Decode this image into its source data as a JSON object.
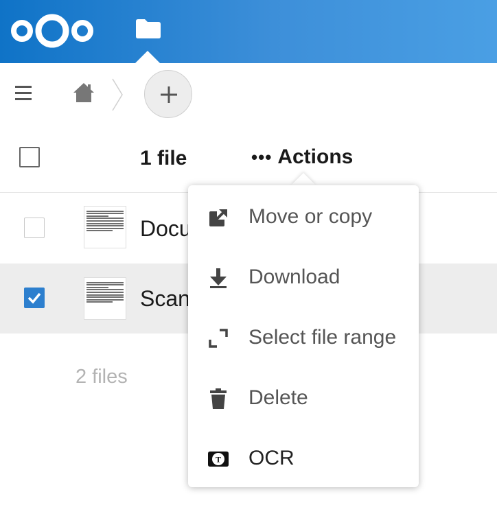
{
  "app": {
    "logo_icon": "nextcloud-logo",
    "files_icon": "folder-icon",
    "brand_color": "#0f73c7"
  },
  "controls": {
    "menu_icon": "hamburger-icon",
    "home_icon": "home-icon",
    "add_icon": "plus-icon"
  },
  "list": {
    "header": {
      "selected_count": "1 file",
      "actions_label": "Actions"
    },
    "rows": [
      {
        "name": "Docu",
        "selected": false
      },
      {
        "name": "Scan",
        "selected": true
      }
    ],
    "summary": "2 files"
  },
  "actions_menu": {
    "items": [
      {
        "label": "Move or copy",
        "icon": "external-link-icon"
      },
      {
        "label": "Download",
        "icon": "download-icon"
      },
      {
        "label": "Select file range",
        "icon": "expand-icon"
      },
      {
        "label": "Delete",
        "icon": "trash-icon"
      },
      {
        "label": "OCR",
        "icon": "ocr-icon"
      }
    ]
  }
}
